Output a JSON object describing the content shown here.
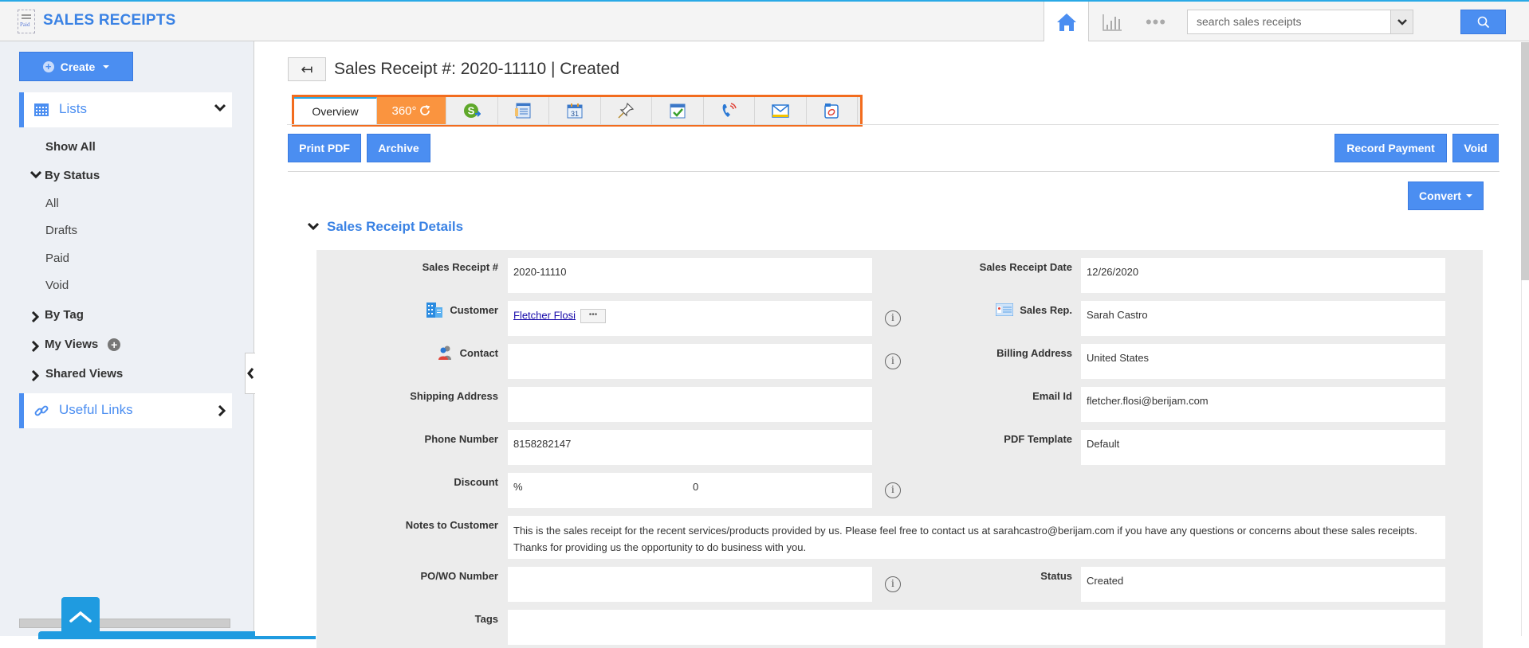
{
  "header": {
    "app_title": "SALES RECEIPTS",
    "app_icon": "paid-receipt-icon",
    "nav": [
      {
        "name": "home",
        "icon": "home-icon",
        "active": true
      },
      {
        "name": "reports",
        "icon": "bar-chart-icon"
      },
      {
        "name": "more",
        "icon": "more-dots-icon",
        "label": "•••"
      }
    ],
    "search": {
      "placeholder": "search sales receipts",
      "value": ""
    },
    "accent_color": "#3a82e4"
  },
  "sidebar": {
    "create_label": "Create",
    "lists_label": "Lists",
    "show_all": "Show All",
    "by_status": {
      "label": "By Status",
      "items": [
        "All",
        "Drafts",
        "Paid",
        "Void"
      ]
    },
    "by_tag": "By Tag",
    "my_views": "My Views",
    "shared_views": "Shared Views",
    "useful_links": "Useful Links"
  },
  "main": {
    "back_label": "↤",
    "title": "Sales Receipt #: 2020-11110 | Created",
    "tabs": [
      {
        "label": "Overview",
        "active": true
      },
      {
        "label": "360°",
        "icon": "360-refresh-icon"
      },
      {
        "icon": "payment-dollar-icon"
      },
      {
        "icon": "details-card-icon"
      },
      {
        "icon": "calendar-icon",
        "label": "31"
      },
      {
        "icon": "pin-icon"
      },
      {
        "icon": "task-check-icon"
      },
      {
        "icon": "phone-call-icon"
      },
      {
        "icon": "email-icon"
      },
      {
        "icon": "attachment-icon"
      }
    ],
    "actions_left": [
      "Print PDF",
      "Archive"
    ],
    "actions_right": [
      "Record Payment",
      "Void"
    ],
    "convert_label": "Convert",
    "section_title": "Sales Receipt Details",
    "fields": {
      "sales_receipt_no": {
        "label": "Sales Receipt #",
        "value": "2020-11110"
      },
      "customer": {
        "label": "Customer",
        "value": "Fletcher Flosi",
        "more": "•••"
      },
      "contact": {
        "label": "Contact",
        "value": ""
      },
      "shipping_address": {
        "label": "Shipping Address",
        "value": ""
      },
      "phone_number": {
        "label": "Phone Number",
        "value": "8158282147"
      },
      "discount": {
        "label": "Discount",
        "unit": "%",
        "value": "0"
      },
      "notes_to_customer": {
        "label": "Notes to Customer",
        "value": "This is the sales receipt for the recent services/products provided by us. Please feel free to contact us at sarahcastro@berijam.com if you have any questions or concerns about these sales receipts. Thanks for providing us the opportunity to do business with you."
      },
      "po_wo_number": {
        "label": "PO/WO Number",
        "value": ""
      },
      "tags": {
        "label": "Tags",
        "value": ""
      },
      "sales_receipt_date": {
        "label": "Sales Receipt Date",
        "value": "12/26/2020"
      },
      "sales_rep": {
        "label": "Sales Rep.",
        "value": "Sarah Castro"
      },
      "billing_address": {
        "label": "Billing Address",
        "value": "United States"
      },
      "email_id": {
        "label": "Email Id",
        "value": "fletcher.flosi@berijam.com"
      },
      "pdf_template": {
        "label": "PDF Template",
        "value": "Default"
      },
      "status": {
        "label": "Status",
        "value": "Created"
      }
    }
  }
}
